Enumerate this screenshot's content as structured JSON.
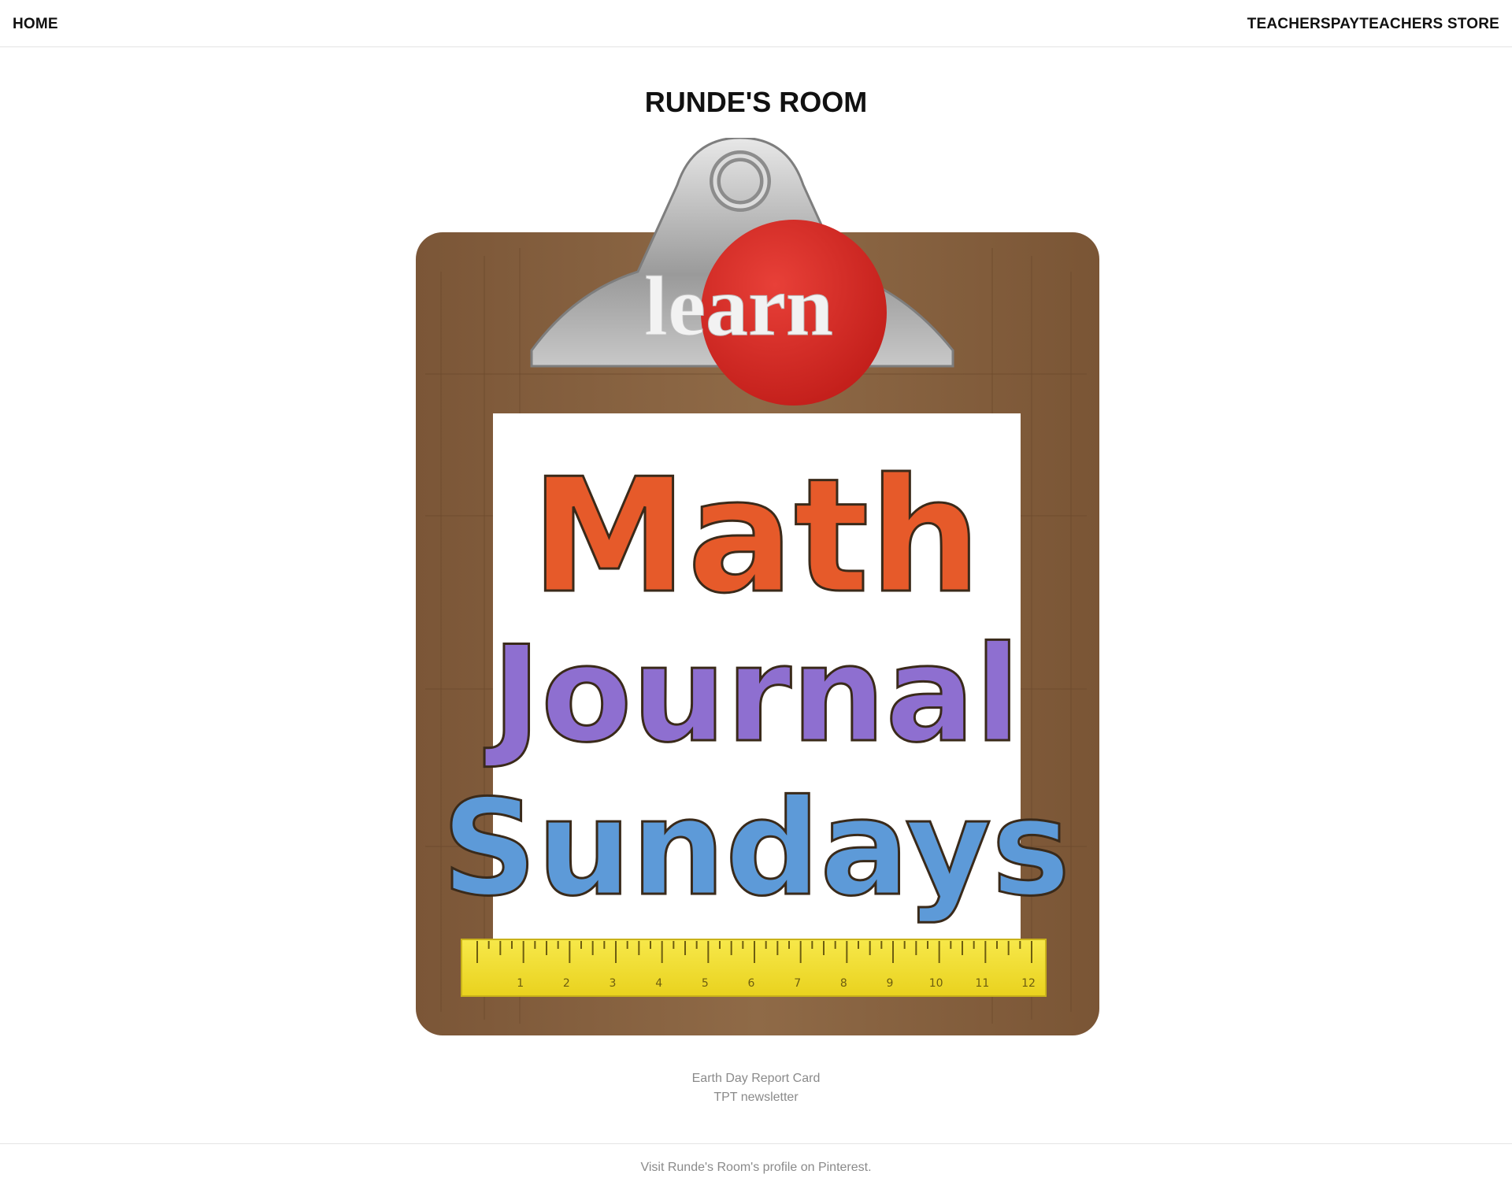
{
  "nav": {
    "home_label": "HOME",
    "store_label": "TEACHERSPAYTEACHERS STORE"
  },
  "page": {
    "title": "RUNDE'S ROOM"
  },
  "featured_image": {
    "badge_text": "learn",
    "lines": [
      "Math",
      "Journal",
      "Sundays"
    ],
    "ruler_numbers": [
      "1",
      "2",
      "3",
      "4",
      "5",
      "6",
      "7",
      "8",
      "9",
      "10",
      "11",
      "12"
    ],
    "colors": {
      "wood": "#8a6544",
      "badge_red": "#d42a24",
      "ruler_yellow": "#f4e23a"
    }
  },
  "links": {
    "item1": "Earth Day Report Card",
    "item2": "TPT newsletter"
  },
  "footer": {
    "text": "Visit Runde's Room's profile on Pinterest."
  }
}
